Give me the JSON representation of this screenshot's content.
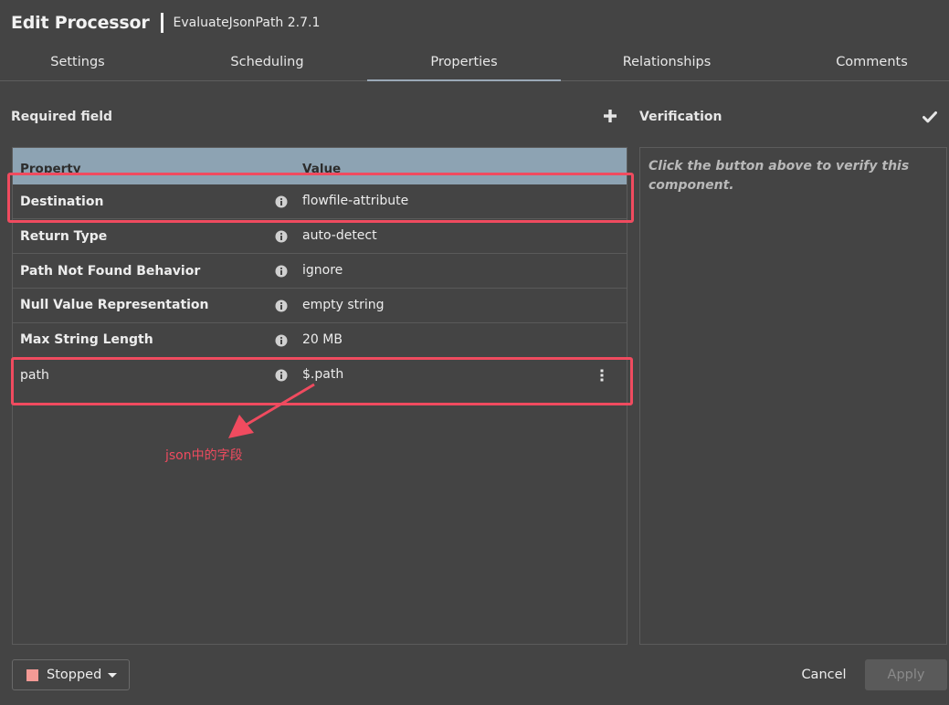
{
  "header": {
    "title": "Edit Processor",
    "subtitle": "EvaluateJsonPath 2.7.1"
  },
  "tabs": [
    {
      "label": "Settings",
      "active": false
    },
    {
      "label": "Scheduling",
      "active": false
    },
    {
      "label": "Properties",
      "active": true
    },
    {
      "label": "Relationships",
      "active": false
    },
    {
      "label": "Comments",
      "active": false
    }
  ],
  "properties": {
    "required_label": "Required field",
    "add_icon": "plus-icon",
    "columns": {
      "property": "Property",
      "value": "Value"
    },
    "rows": [
      {
        "name": "Destination",
        "value": "flowfile-attribute",
        "required": true
      },
      {
        "name": "Return Type",
        "value": "auto-detect",
        "required": true
      },
      {
        "name": "Path Not Found Behavior",
        "value": "ignore",
        "required": true
      },
      {
        "name": "Null Value Representation",
        "value": "empty string",
        "required": true
      },
      {
        "name": "Max String Length",
        "value": "20 MB",
        "required": true
      },
      {
        "name": "path",
        "value": "$.path",
        "required": false
      }
    ]
  },
  "verification": {
    "label": "Verification",
    "icon": "checkmark-icon",
    "hint": "Click the button above to verify this component."
  },
  "annotation": {
    "text": "json中的字段",
    "color": "#f04b5f"
  },
  "footer": {
    "state_label": "Stopped",
    "state_color": "#f49a95",
    "cancel_label": "Cancel",
    "apply_label": "Apply"
  }
}
